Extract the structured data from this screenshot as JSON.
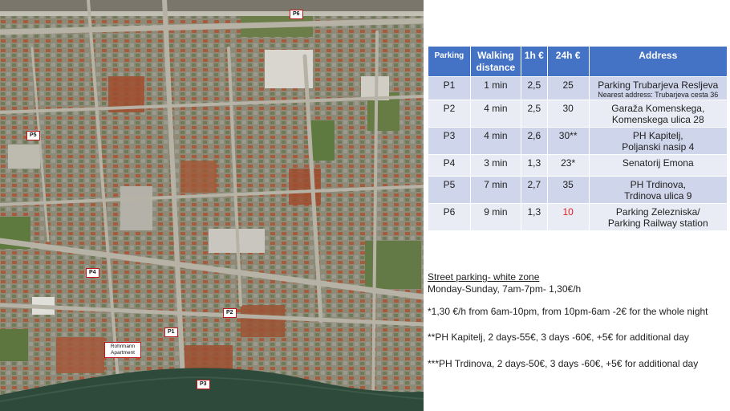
{
  "map": {
    "markers": [
      {
        "id": "p6",
        "label": "P6"
      },
      {
        "id": "p5",
        "label": "P5"
      },
      {
        "id": "p4",
        "label": "P4"
      },
      {
        "id": "p2",
        "label": "P2"
      },
      {
        "id": "p1",
        "label": "P1"
      },
      {
        "id": "home",
        "label": "Rohrmann Apartment"
      },
      {
        "id": "p3",
        "label": "P3"
      }
    ],
    "colors": {
      "marker_border": "#c0171d",
      "river": "#2e4a3a",
      "road": "#b7b2a6"
    }
  },
  "table": {
    "headers": [
      "Parking",
      "Walking distance",
      "1h €",
      "24h €",
      "Address"
    ],
    "header_color": "#4472c4",
    "rows": [
      {
        "parking": "P1",
        "walk": "1 min",
        "h1": "2,5",
        "h24": "25",
        "address": "Parking Trubarjeva Resljeva",
        "address2": "Nearest address: Trubarjeva cesta 36"
      },
      {
        "parking": "P2",
        "walk": "4 min",
        "h1": "2,5",
        "h24": "30",
        "address": "Garaža Komenskega,",
        "address2": "Komenskega ulica 28"
      },
      {
        "parking": "P3",
        "walk": "4 min",
        "h1": "2,6",
        "h24": "30**",
        "address": "PH Kapitelj,",
        "address2": "Poljanski nasip 4"
      },
      {
        "parking": "P4",
        "walk": "3 min",
        "h1": "1,3",
        "h24": "23*",
        "address": "Senatorij Emona",
        "address2": ""
      },
      {
        "parking": "P5",
        "walk": "7 min",
        "h1": "2,7",
        "h24": "35",
        "address": "PH Trdinova,",
        "address2": "Trdinova ulica 9"
      },
      {
        "parking": "P6",
        "walk": "9 min",
        "h1": "1,3",
        "h24": "10",
        "address": "Parking Zelezniska/",
        "address2": "Parking Railway station"
      }
    ]
  },
  "notes": {
    "street_title": "Street parking- white zone",
    "street_hours": "Monday-Sunday, 7am-7pm- 1,30€/h",
    "note1": "*1,30 €/h from 6am-10pm, from 10pm-6am -2€ for the whole night",
    "note2": "**PH Kapitelj, 2 days-55€, 3 days -60€, +5€ for additional day",
    "note3": "***PH Trdinova, 2 days-50€, 3 days -60€, +5€ for additional day"
  }
}
